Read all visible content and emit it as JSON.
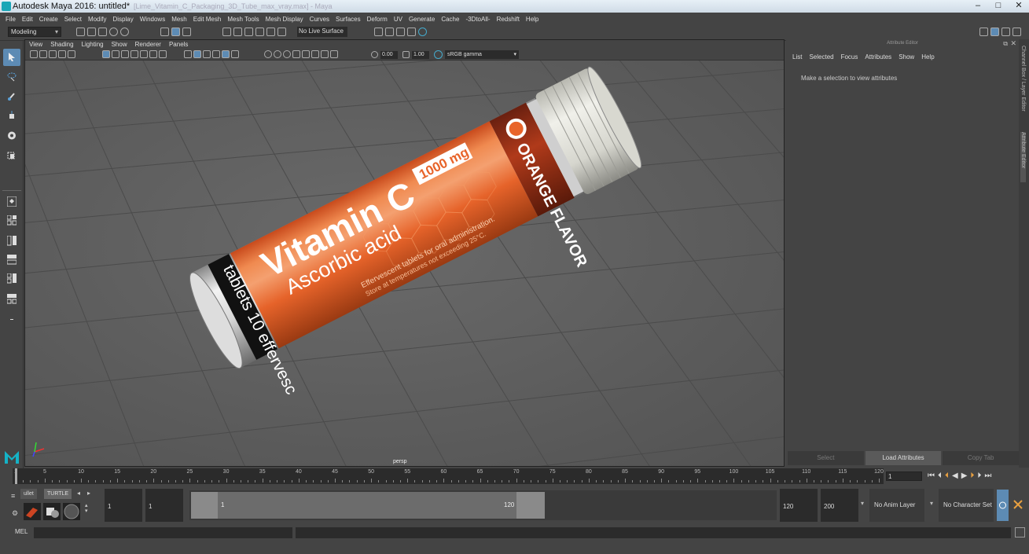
{
  "title": "Autodesk Maya 2016: untitled*",
  "title_ghost": "[Lime_Vitamin_C_Packaging_3D_Tube_max_vray.max] - Maya",
  "menu": [
    "File",
    "Edit",
    "Create",
    "Select",
    "Modify",
    "Display",
    "Windows",
    "Mesh",
    "Edit Mesh",
    "Mesh Tools",
    "Mesh Display",
    "Curves",
    "Surfaces",
    "Deform",
    "UV",
    "Generate",
    "Cache",
    "-3DtoAll-",
    "Redshift",
    "Help"
  ],
  "status": {
    "mode": "Modeling",
    "live_surface": "No Live Surface"
  },
  "viewport": {
    "menu": [
      "View",
      "Shading",
      "Lighting",
      "Show",
      "Renderer",
      "Panels"
    ],
    "value_a": "0.00",
    "value_b": "1.00",
    "color_space": "sRGB gamma",
    "camera": "persp"
  },
  "product": {
    "title": "Vitamin C",
    "dose": "1000 mg",
    "subtitle": "Ascorbic acid",
    "flavor": "ORANGE FLAVOR",
    "band": "tablets 10 effervesc",
    "note1": "Effervescent tablets for oral administration.",
    "note2": "Store at temperatures not exceeding 25°C."
  },
  "attribute_editor": {
    "title": "Attribute Editor",
    "menu": [
      "List",
      "Selected",
      "Focus",
      "Attributes",
      "Show",
      "Help"
    ],
    "message": "Make a selection to view attributes",
    "buttons": [
      "Select",
      "Load Attributes",
      "Copy Tab"
    ]
  },
  "side_tabs": [
    "Channel Box / Layer Editor",
    "Attribute Editor"
  ],
  "timeline": {
    "ticks": [
      "1",
      "5",
      "10",
      "15",
      "20",
      "25",
      "30",
      "35",
      "40",
      "45",
      "50",
      "55",
      "60",
      "65",
      "70",
      "75",
      "80",
      "85",
      "90",
      "95",
      "100",
      "105",
      "110",
      "115",
      "120"
    ],
    "current_frame": "1"
  },
  "range": {
    "shelf_tabs": [
      "ullet",
      "TURTLE"
    ],
    "start": "1",
    "range_start": "1",
    "handle_start": "1",
    "handle_end": "120",
    "range_end": "120",
    "end": "200",
    "anim_layer": "No Anim Layer",
    "char_set": "No Character Set"
  },
  "mel_label": "MEL",
  "colors": {
    "accent": "#5d8bb4",
    "orange": "#e8642a",
    "viewport_bg": "#606060"
  }
}
